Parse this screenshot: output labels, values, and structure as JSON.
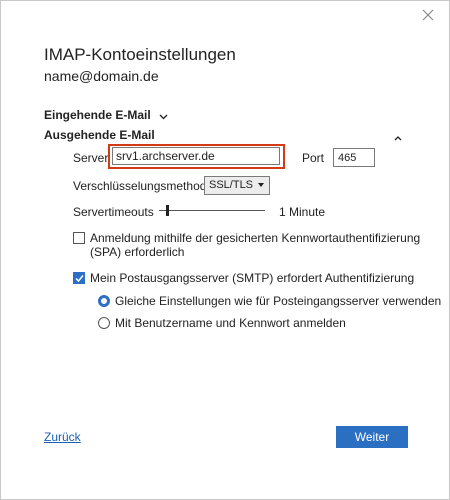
{
  "dialog": {
    "title": "IMAP-Kontoeinstellungen",
    "email": "name@domain.de"
  },
  "incoming": {
    "label": "Eingehende E-Mail"
  },
  "outgoing": {
    "label": "Ausgehende E-Mail",
    "server_label": "Server",
    "server_value": "srv1.archserver.de",
    "port_label": "Port",
    "port_value": "465",
    "encryption_label": "Verschlüsselungsmethode",
    "encryption_value": "SSL/TLS",
    "timeout_label": "Servertimeouts",
    "timeout_value": "1 Minute",
    "timeout_slider_fraction": 0.07,
    "spa_label_line1": "Anmeldung mithilfe der gesicherten Kennwortauthentifizierung",
    "spa_label_line2": "(SPA) erforderlich",
    "spa_checked": false,
    "smtp_auth_label": "Mein Postausgangsserver (SMTP) erfordert Authentifizierung",
    "smtp_auth_checked": true,
    "same_settings_label": "Gleiche Einstellungen wie für Posteingangsserver verwenden",
    "same_settings_selected": true,
    "username_label": "Mit Benutzername und Kennwort anmelden",
    "username_selected": false
  },
  "footer": {
    "back_label": "Zurück",
    "next_label": "Weiter"
  },
  "colors": {
    "accent": "#2b6fc3",
    "highlight": "#d43a16",
    "link": "#1b5fb5"
  }
}
